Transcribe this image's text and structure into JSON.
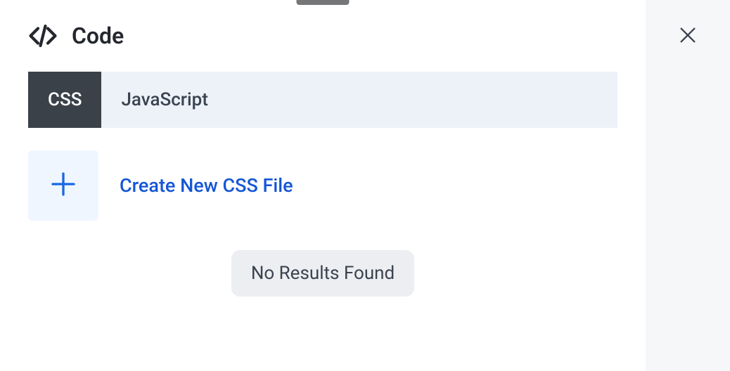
{
  "header": {
    "title": "Code"
  },
  "tabs": {
    "css": "CSS",
    "javascript": "JavaScript"
  },
  "create": {
    "label": "Create New CSS File"
  },
  "results": {
    "empty_message": "No Results Found"
  }
}
